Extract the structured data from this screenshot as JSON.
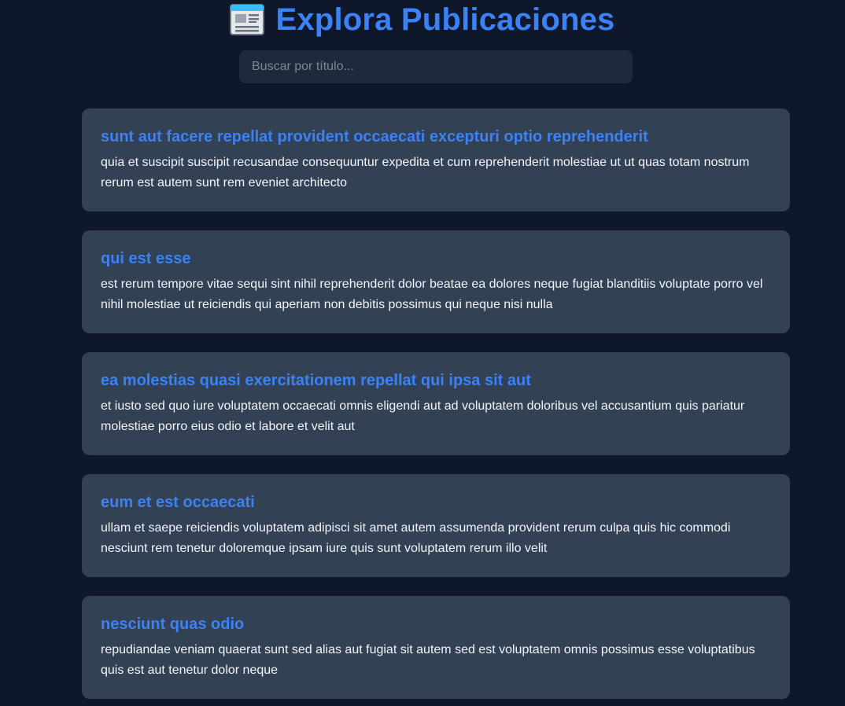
{
  "header": {
    "icon": "newspaper-icon",
    "title": "Explora Publicaciones"
  },
  "search": {
    "placeholder": "Buscar por título...",
    "value": ""
  },
  "colors": {
    "background": "#0f172a",
    "card": "#334155",
    "accent": "#3b82f6",
    "input": "#1e293b"
  },
  "posts": [
    {
      "title": "sunt aut facere repellat provident occaecati excepturi optio reprehenderit",
      "body": "quia et suscipit suscipit recusandae consequuntur expedita et cum reprehenderit molestiae ut ut quas totam nostrum rerum est autem sunt rem eveniet architecto"
    },
    {
      "title": "qui est esse",
      "body": "est rerum tempore vitae sequi sint nihil reprehenderit dolor beatae ea dolores neque fugiat blanditiis voluptate porro vel nihil molestiae ut reiciendis qui aperiam non debitis possimus qui neque nisi nulla"
    },
    {
      "title": "ea molestias quasi exercitationem repellat qui ipsa sit aut",
      "body": "et iusto sed quo iure voluptatem occaecati omnis eligendi aut ad voluptatem doloribus vel accusantium quis pariatur molestiae porro eius odio et labore et velit aut"
    },
    {
      "title": "eum et est occaecati",
      "body": "ullam et saepe reiciendis voluptatem adipisci sit amet autem assumenda provident rerum culpa quis hic commodi nesciunt rem tenetur doloremque ipsam iure quis sunt voluptatem rerum illo velit"
    },
    {
      "title": "nesciunt quas odio",
      "body": "repudiandae veniam quaerat sunt sed alias aut fugiat sit autem sed est voluptatem omnis possimus esse voluptatibus quis est aut tenetur dolor neque"
    }
  ]
}
